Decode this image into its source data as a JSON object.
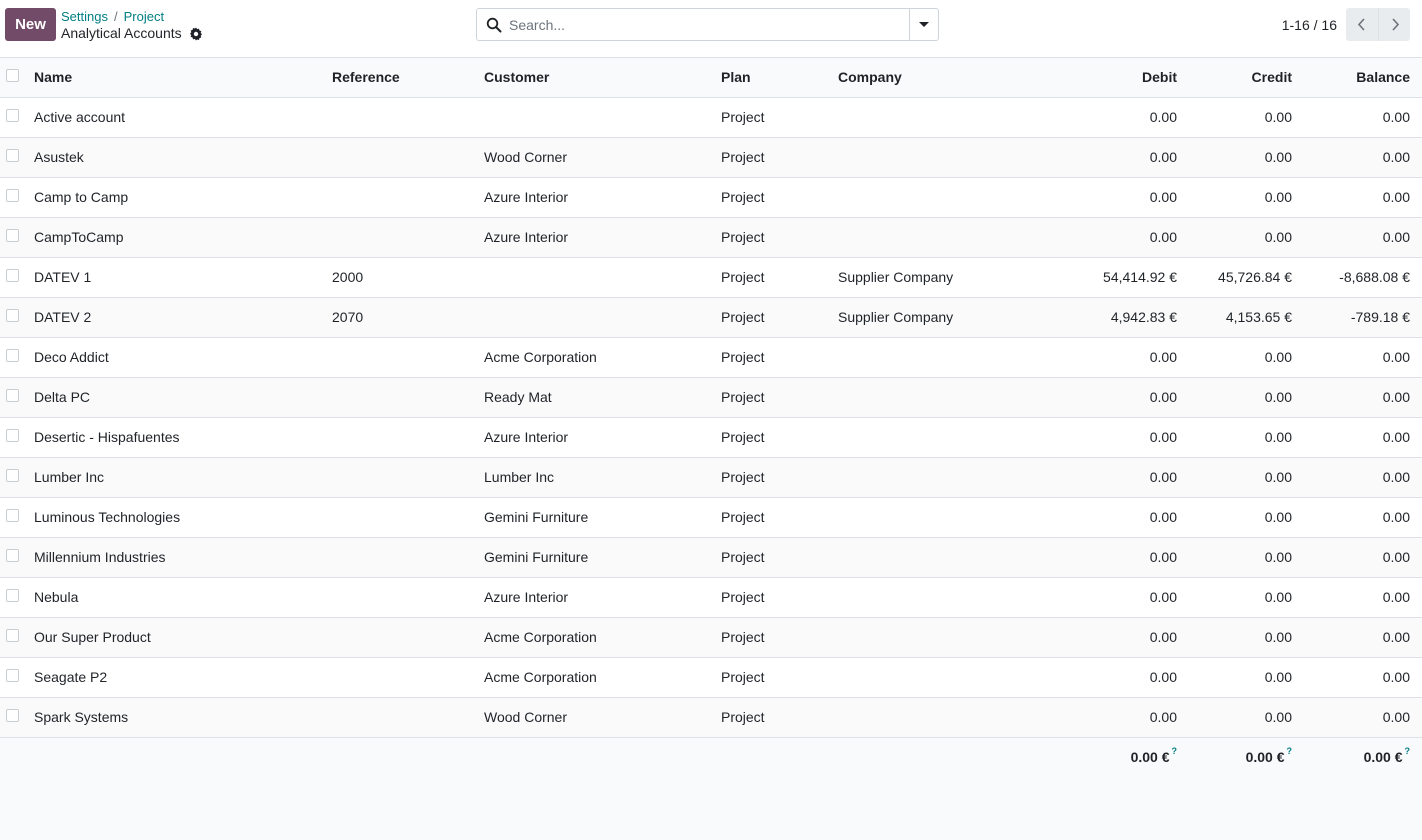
{
  "toolbar": {
    "new_label": "New"
  },
  "breadcrumb": {
    "items": [
      "Settings",
      "Project"
    ],
    "separator": "/"
  },
  "page": {
    "title": "Analytical Accounts"
  },
  "search": {
    "placeholder": "Search..."
  },
  "pager": {
    "value": "1-16 / 16"
  },
  "icons": {
    "gear": "gear-icon",
    "search": "search-icon",
    "caret": "caret-down-icon",
    "prev": "chevron-left-icon",
    "next": "chevron-right-icon"
  },
  "colors": {
    "brand": "#714b67",
    "link": "#017e84",
    "border": "#dee2e6"
  },
  "table": {
    "columns": {
      "name": "Name",
      "reference": "Reference",
      "customer": "Customer",
      "plan": "Plan",
      "company": "Company",
      "debit": "Debit",
      "credit": "Credit",
      "balance": "Balance"
    },
    "rows": [
      {
        "name": "Active account",
        "reference": "",
        "customer": "",
        "plan": "Project",
        "company": "",
        "debit": "0.00",
        "credit": "0.00",
        "balance": "0.00"
      },
      {
        "name": "Asustek",
        "reference": "",
        "customer": "Wood Corner",
        "plan": "Project",
        "company": "",
        "debit": "0.00",
        "credit": "0.00",
        "balance": "0.00"
      },
      {
        "name": "Camp to Camp",
        "reference": "",
        "customer": "Azure Interior",
        "plan": "Project",
        "company": "",
        "debit": "0.00",
        "credit": "0.00",
        "balance": "0.00"
      },
      {
        "name": "CampToCamp",
        "reference": "",
        "customer": "Azure Interior",
        "plan": "Project",
        "company": "",
        "debit": "0.00",
        "credit": "0.00",
        "balance": "0.00"
      },
      {
        "name": "DATEV 1",
        "reference": "2000",
        "customer": "",
        "plan": "Project",
        "company": "Supplier Company",
        "debit": "54,414.92 €",
        "credit": "45,726.84 €",
        "balance": "-8,688.08 €"
      },
      {
        "name": "DATEV 2",
        "reference": "2070",
        "customer": "",
        "plan": "Project",
        "company": "Supplier Company",
        "debit": "4,942.83 €",
        "credit": "4,153.65 €",
        "balance": "-789.18 €"
      },
      {
        "name": "Deco Addict",
        "reference": "",
        "customer": "Acme Corporation",
        "plan": "Project",
        "company": "",
        "debit": "0.00",
        "credit": "0.00",
        "balance": "0.00"
      },
      {
        "name": "Delta PC",
        "reference": "",
        "customer": "Ready Mat",
        "plan": "Project",
        "company": "",
        "debit": "0.00",
        "credit": "0.00",
        "balance": "0.00"
      },
      {
        "name": "Desertic - Hispafuentes",
        "reference": "",
        "customer": "Azure Interior",
        "plan": "Project",
        "company": "",
        "debit": "0.00",
        "credit": "0.00",
        "balance": "0.00"
      },
      {
        "name": "Lumber Inc",
        "reference": "",
        "customer": "Lumber Inc",
        "plan": "Project",
        "company": "",
        "debit": "0.00",
        "credit": "0.00",
        "balance": "0.00"
      },
      {
        "name": "Luminous Technologies",
        "reference": "",
        "customer": "Gemini Furniture",
        "plan": "Project",
        "company": "",
        "debit": "0.00",
        "credit": "0.00",
        "balance": "0.00"
      },
      {
        "name": "Millennium Industries",
        "reference": "",
        "customer": "Gemini Furniture",
        "plan": "Project",
        "company": "",
        "debit": "0.00",
        "credit": "0.00",
        "balance": "0.00"
      },
      {
        "name": "Nebula",
        "reference": "",
        "customer": "Azure Interior",
        "plan": "Project",
        "company": "",
        "debit": "0.00",
        "credit": "0.00",
        "balance": "0.00"
      },
      {
        "name": "Our Super Product",
        "reference": "",
        "customer": "Acme Corporation",
        "plan": "Project",
        "company": "",
        "debit": "0.00",
        "credit": "0.00",
        "balance": "0.00"
      },
      {
        "name": "Seagate P2",
        "reference": "",
        "customer": "Acme Corporation",
        "plan": "Project",
        "company": "",
        "debit": "0.00",
        "credit": "0.00",
        "balance": "0.00"
      },
      {
        "name": "Spark Systems",
        "reference": "",
        "customer": "Wood Corner",
        "plan": "Project",
        "company": "",
        "debit": "0.00",
        "credit": "0.00",
        "balance": "0.00"
      }
    ],
    "totals": {
      "debit": "0.00 €",
      "credit": "0.00 €",
      "balance": "0.00 €",
      "help_mark": "?"
    }
  }
}
